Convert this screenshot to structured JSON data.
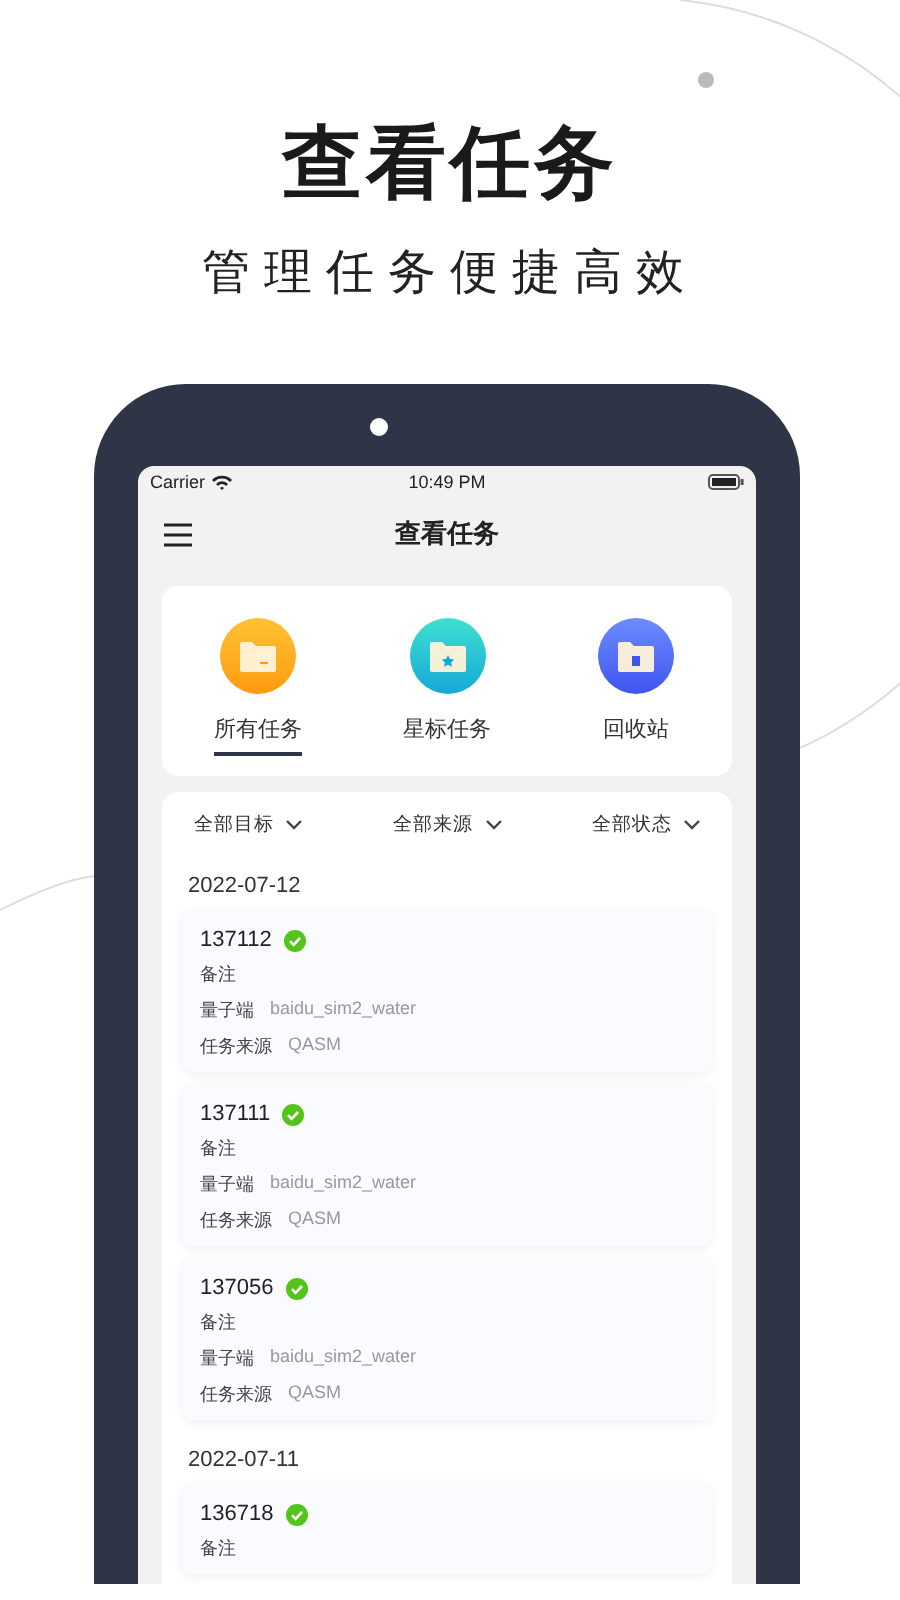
{
  "headline": {
    "title": "查看任务",
    "subtitle": "管理任务便捷高效"
  },
  "status_bar": {
    "carrier": "Carrier",
    "time": "10:49 PM"
  },
  "nav": {
    "title": "查看任务"
  },
  "categories": [
    {
      "label": "所有任务",
      "kind": "folder",
      "selected": true
    },
    {
      "label": "星标任务",
      "kind": "star",
      "selected": false
    },
    {
      "label": "回收站",
      "kind": "trash",
      "selected": false
    }
  ],
  "filters": [
    {
      "label": "全部目标"
    },
    {
      "label": "全部来源"
    },
    {
      "label": "全部状态"
    }
  ],
  "groups": [
    {
      "date": "2022-07-12",
      "tasks": [
        {
          "id": "137112",
          "done": true,
          "note": "备注",
          "fields": [
            {
              "label": "量子端",
              "value": "baidu_sim2_water"
            },
            {
              "label": "任务来源",
              "value": "QASM"
            }
          ]
        },
        {
          "id": "137111",
          "done": true,
          "note": "备注",
          "fields": [
            {
              "label": "量子端",
              "value": "baidu_sim2_water"
            },
            {
              "label": "任务来源",
              "value": "QASM"
            }
          ]
        },
        {
          "id": "137056",
          "done": true,
          "note": "备注",
          "fields": [
            {
              "label": "量子端",
              "value": "baidu_sim2_water"
            },
            {
              "label": "任务来源",
              "value": "QASM"
            }
          ]
        }
      ]
    },
    {
      "date": "2022-07-11",
      "tasks": [
        {
          "id": "136718",
          "done": true,
          "note": "备注"
        }
      ]
    }
  ]
}
